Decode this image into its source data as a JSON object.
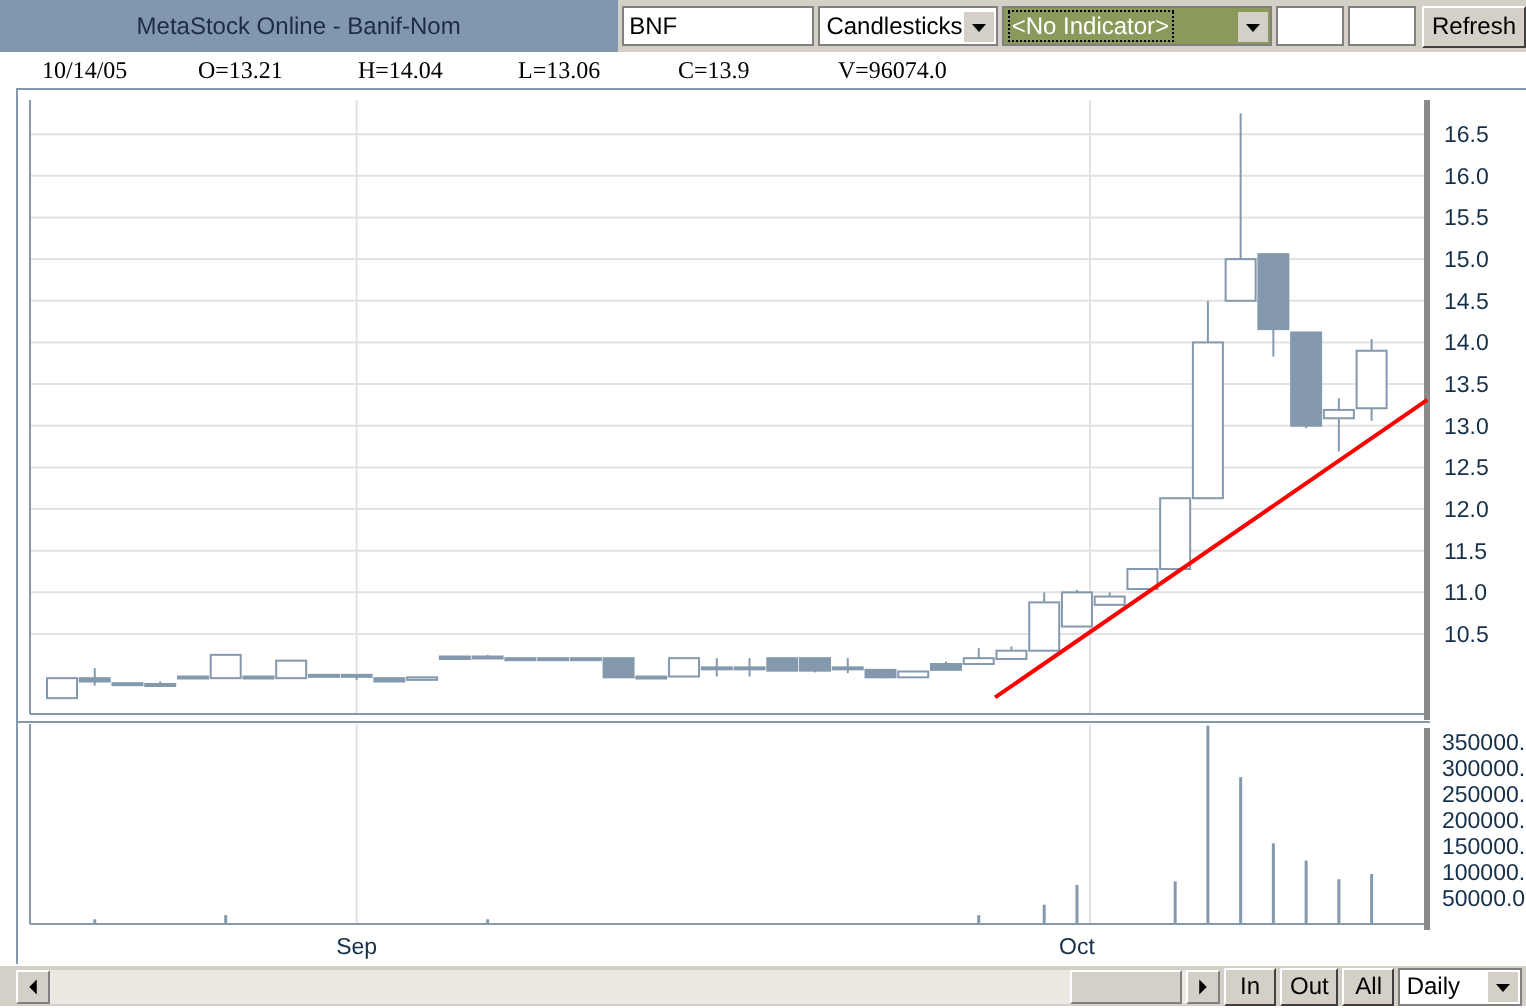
{
  "window": {
    "title": "MetaStock Online - Banif-Nom"
  },
  "toolbar": {
    "symbol_field": {
      "value": "BNF"
    },
    "chart_type": {
      "value": "Candlesticks"
    },
    "indicator": {
      "value": "<No Indicator>"
    },
    "refresh_button": "Refresh"
  },
  "quote_line": {
    "date": "10/14/05",
    "open": "O=13.21",
    "high": "H=14.04",
    "low": "L=13.06",
    "close": "C=13.9",
    "volume": "V=96074.0"
  },
  "price_chart": {
    "chart_data": {
      "type": "candlestick",
      "categories": [
        null,
        null,
        null,
        null,
        null,
        null,
        null,
        null,
        null,
        null,
        null,
        null,
        null,
        null,
        null,
        null,
        null,
        null,
        null,
        null,
        null,
        null,
        null,
        null,
        null,
        null,
        null,
        null,
        null,
        null,
        null,
        null,
        null,
        null,
        null,
        null,
        null,
        null,
        null,
        null,
        null
      ],
      "ylim": [
        9.54,
        16.91
      ],
      "grid": true,
      "yticks": [
        {
          "value": 16.5,
          "label": "16.5"
        },
        {
          "value": 16,
          "label": "16.0"
        },
        {
          "value": 15.5,
          "label": "15.5"
        },
        {
          "value": 15,
          "label": "15.0"
        },
        {
          "value": 14.5,
          "label": "14.5"
        },
        {
          "value": 14,
          "label": "14.0"
        },
        {
          "value": 13.5,
          "label": "13.5"
        },
        {
          "value": 13,
          "label": "13.0"
        },
        {
          "value": 12.5,
          "label": "12.5"
        },
        {
          "value": 12,
          "label": "12.0"
        },
        {
          "value": 11.5,
          "label": "11.5"
        },
        {
          "value": 11,
          "label": "11.0"
        },
        {
          "value": 10.5,
          "label": "10.5"
        }
      ],
      "ohlc": [
        [
          9.73,
          9.97,
          9.73,
          9.97
        ],
        [
          9.97,
          10.09,
          9.88,
          9.93
        ],
        [
          9.91,
          9.91,
          9.91,
          9.91
        ],
        [
          9.9,
          9.93,
          9.88,
          9.9
        ],
        [
          9.99,
          9.99,
          9.98,
          9.98
        ],
        [
          9.97,
          10.25,
          9.97,
          10.25
        ],
        [
          9.99,
          9.99,
          9.99,
          9.99
        ],
        [
          9.97,
          10.18,
          9.97,
          10.18
        ],
        [
          10.01,
          10.01,
          10.01,
          10.01
        ],
        [
          10.01,
          10.01,
          9.95,
          10.01
        ],
        [
          9.97,
          9.97,
          9.93,
          9.93
        ],
        [
          9.95,
          9.98,
          9.95,
          9.98
        ],
        [
          10.23,
          10.23,
          10.2,
          10.2
        ],
        [
          10.23,
          10.25,
          10.2,
          10.23
        ],
        [
          10.21,
          10.21,
          10.21,
          10.21
        ],
        [
          10.21,
          10.21,
          10.21,
          10.21
        ],
        [
          10.21,
          10.21,
          10.21,
          10.21
        ],
        [
          10.21,
          10.21,
          9.98,
          9.98
        ],
        [
          9.99,
          9.99,
          9.99,
          9.99
        ],
        [
          9.99,
          10.21,
          9.99,
          10.21
        ],
        [
          10.1,
          10.21,
          9.99,
          10.1
        ],
        [
          10.1,
          10.21,
          9.99,
          10.1
        ],
        [
          10.21,
          10.21,
          10.06,
          10.06
        ],
        [
          10.21,
          10.21,
          10.04,
          10.06
        ],
        [
          10.1,
          10.21,
          10.03,
          10.1
        ],
        [
          10.07,
          10.07,
          9.97,
          9.98
        ],
        [
          9.98,
          10.05,
          9.98,
          10.05
        ],
        [
          10.14,
          10.17,
          10.07,
          10.07
        ],
        [
          10.14,
          10.33,
          10.14,
          10.21
        ],
        [
          10.2,
          10.35,
          10.2,
          10.3
        ],
        [
          10.3,
          11.0,
          10.3,
          10.88
        ],
        [
          10.59,
          11.03,
          10.59,
          11.0
        ],
        [
          10.85,
          11.0,
          10.85,
          10.95
        ],
        [
          11.04,
          11.28,
          11.04,
          11.28
        ],
        [
          11.28,
          12.13,
          11.28,
          12.13
        ],
        [
          12.13,
          14.5,
          12.13,
          14.0
        ],
        [
          14.5,
          16.75,
          14.5,
          15.0
        ],
        [
          15.06,
          15.06,
          13.83,
          14.16
        ],
        [
          14.12,
          14.12,
          12.97,
          13.0
        ],
        [
          13.09,
          13.33,
          12.69,
          13.19
        ],
        [
          13.21,
          14.04,
          13.06,
          13.9
        ]
      ]
    }
  },
  "volume_chart": {
    "chart_data": {
      "type": "bar",
      "categories": [
        null,
        null,
        null,
        null,
        null,
        null,
        null,
        null,
        null,
        "Sep",
        null,
        null,
        null,
        null,
        null,
        null,
        null,
        null,
        null,
        null,
        null,
        null,
        null,
        null,
        null,
        null,
        null,
        null,
        null,
        null,
        null,
        "Oct",
        null,
        null,
        null,
        null,
        null,
        null,
        null,
        null,
        null
      ],
      "ylim": [
        0,
        388000
      ],
      "grid": true,
      "yticks": [
        {
          "value": 350000,
          "label": "350000."
        },
        {
          "value": 300000,
          "label": "300000."
        },
        {
          "value": 250000,
          "label": "250000."
        },
        {
          "value": 200000,
          "label": "200000."
        },
        {
          "value": 150000,
          "label": "150000."
        },
        {
          "value": 100000,
          "label": "100000."
        },
        {
          "value": 50000,
          "label": "50000.0"
        }
      ],
      "series": [
        {
          "color": "#8499ad",
          "values": [
            null,
            9000,
            null,
            null,
            null,
            17000,
            null,
            null,
            null,
            null,
            null,
            null,
            null,
            9000,
            null,
            null,
            null,
            null,
            null,
            null,
            null,
            null,
            null,
            null,
            null,
            null,
            null,
            null,
            17000,
            null,
            37000,
            75000,
            null,
            null,
            82000,
            381000,
            282000,
            155000,
            122000,
            86000,
            96000
          ]
        }
      ]
    }
  },
  "bottom_bar": {
    "buttons": [
      "In",
      "Out",
      "All"
    ],
    "period": {
      "value": "Daily"
    }
  }
}
